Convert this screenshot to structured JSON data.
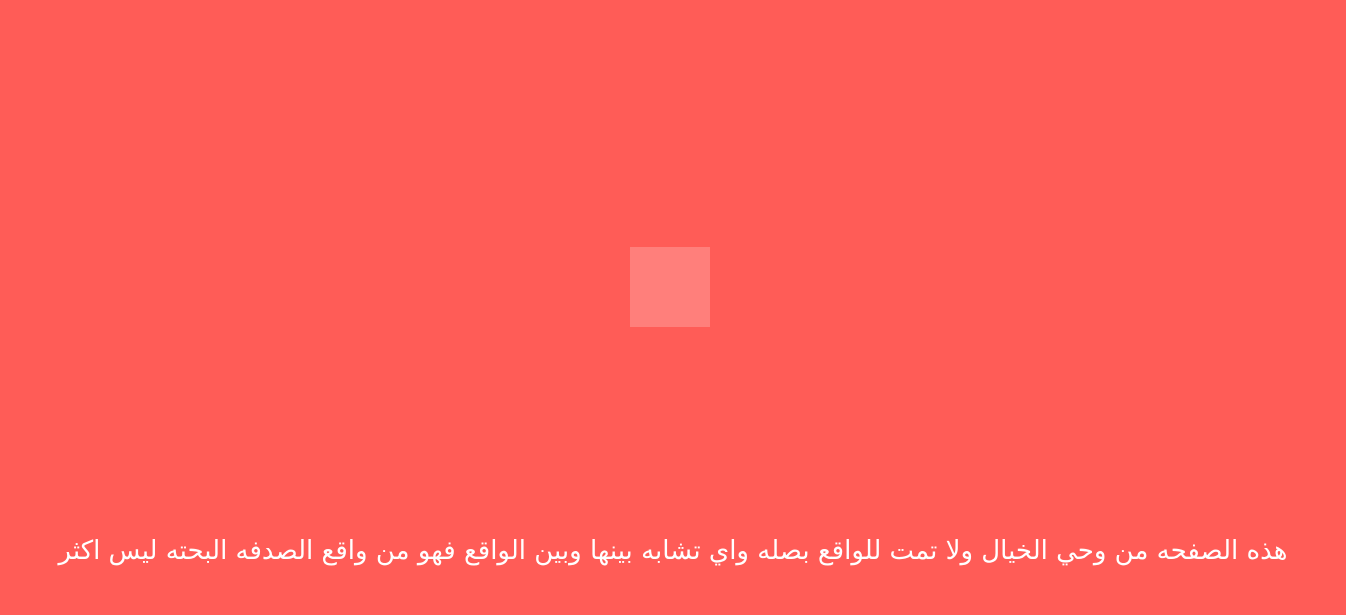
{
  "colors": {
    "background": "#ff5c57",
    "loader": "#ff7f7b",
    "text": "#ffffff"
  },
  "loader": {
    "icon": "square-loading-placeholder"
  },
  "footer": {
    "disclaimer": "هذه الصفحه من وحي الخيال ولا تمت للواقع بصله واي تشابه بينها وبين الواقع فهو من واقع الصدفه البحته ليس اكثر"
  }
}
